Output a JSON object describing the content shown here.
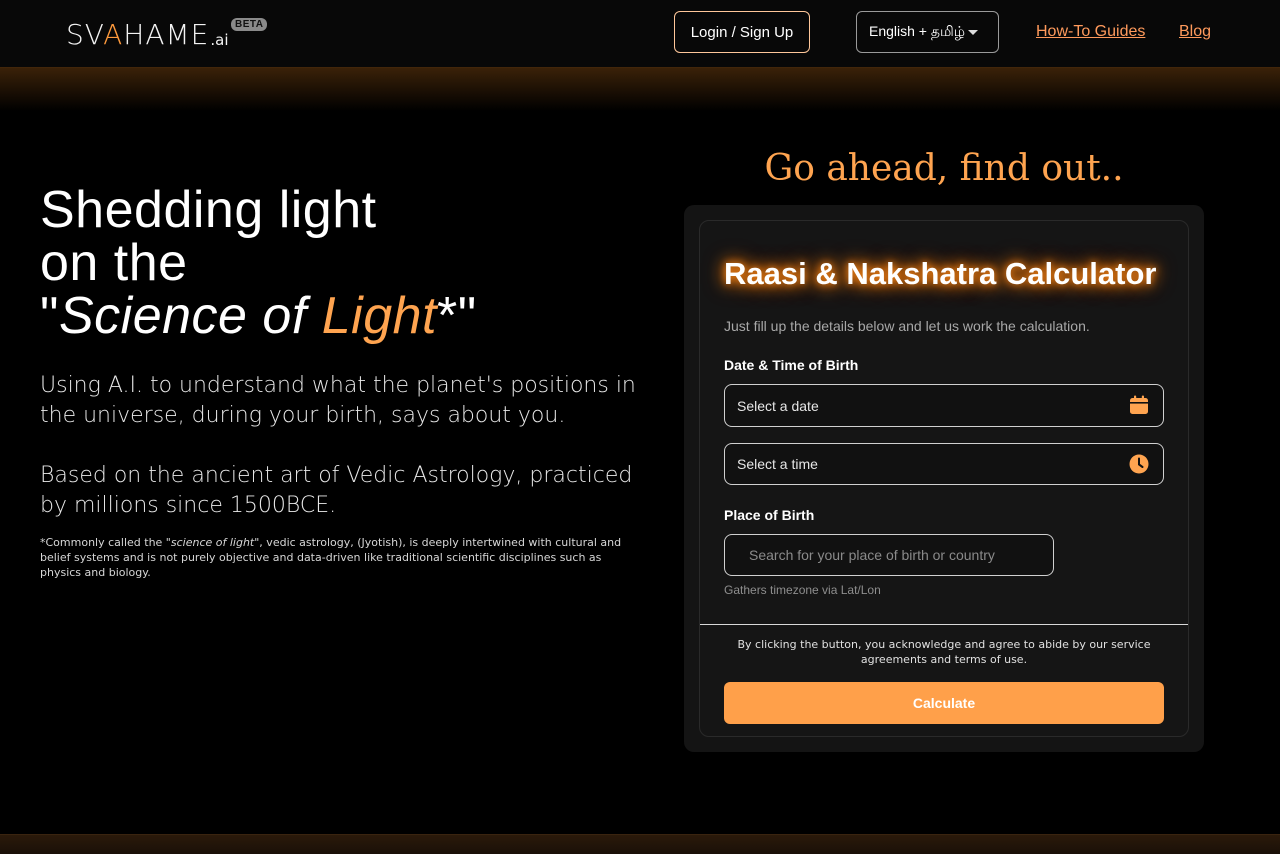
{
  "header": {
    "logo": {
      "text_before": "SV",
      "flame": "A",
      "text_after": "HAME",
      "suffix": ".ai",
      "badge": "BETA"
    },
    "login_label": "Login / Sign Up",
    "language": "English + தமிழ்",
    "nav": [
      {
        "label": "How-To Guides"
      },
      {
        "label": "Blog"
      }
    ]
  },
  "hero": {
    "title_line1": "Shedding light",
    "title_line2": "on the",
    "title_quote_open": "\"",
    "title_em": "Science of ",
    "title_orange": "Light",
    "title_end": "*\"",
    "para1": "Using A.I. to understand what the planet's positions in the universe, during your birth, says about you.",
    "para2": "Based on the ancient art of Vedic Astrology, practiced by millions since 1500BCE.",
    "footnote_before": "*Commonly called the \"",
    "footnote_em": "science of light",
    "footnote_after": "\", vedic astrology, (Jyotish), is deeply intertwined with cultural and belief systems and is not purely objective and data-driven like traditional scientific disciplines such as physics and biology."
  },
  "calculator": {
    "heading": "Go ahead, find out..",
    "title": "Raasi & Nakshatra Calculator",
    "subtitle": "Just fill up the details below and let us work the calculation.",
    "dob_label": "Date & Time of Birth",
    "date_placeholder": "Select a date",
    "time_placeholder": "Select a time",
    "place_label": "Place of Birth",
    "place_placeholder": "Search for your place of birth or country",
    "place_hint": "Gathers timezone via Lat/Lon",
    "consent": "By clicking the button, you acknowledge and agree to abide by our service agreements and terms of use.",
    "button_label": "Calculate"
  },
  "colors": {
    "accent": "#ffa450",
    "link": "#ff9a5c",
    "button": "#ffa04a"
  },
  "icons": {
    "date": "calendar-icon",
    "time": "clock-icon",
    "language": "chevron-down-icon"
  }
}
